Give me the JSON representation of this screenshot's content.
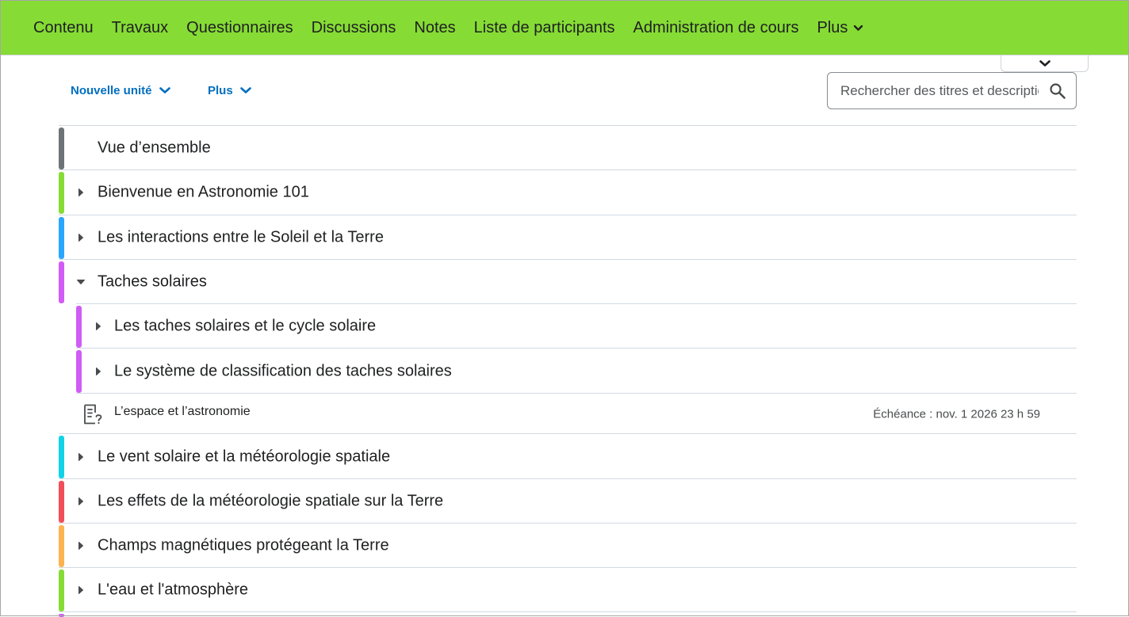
{
  "nav": {
    "items": [
      "Contenu",
      "Travaux",
      "Questionnaires",
      "Discussions",
      "Notes",
      "Liste de participants",
      "Administration de cours"
    ],
    "more_label": "Plus",
    "color": "#86dc34"
  },
  "toolbar": {
    "new_unit_label": "Nouvelle unité",
    "more_label": "Plus",
    "link_color": "#006fbf"
  },
  "search": {
    "placeholder": "Rechercher des titres et descriptions",
    "value": ""
  },
  "content": {
    "overview": {
      "title": "Vue d’ensemble",
      "color": "#6e7376"
    },
    "units": [
      {
        "title": "Bienvenue en Astronomie 101",
        "color": "#86dc34",
        "expanded": false
      },
      {
        "title": "Les interactions entre le Soleil et la Terre",
        "color": "#29a6ff",
        "expanded": false
      },
      {
        "title": "Taches solaires",
        "color": "#d05cf5",
        "expanded": true
      }
    ],
    "subunits": [
      {
        "title": "Les taches solaires et le cycle solaire",
        "color": "#d05cf5"
      },
      {
        "title": "Le système de classification des taches solaires",
        "color": "#d05cf5"
      }
    ],
    "activity": {
      "title": "L’espace et l’astronomie",
      "due": "Échéance : nov. 1 2026 23 h 59",
      "icon": "quiz-icon"
    },
    "units_after": [
      {
        "title": "Le vent solaire et la météorologie spatiale",
        "color": "#11d3e8"
      },
      {
        "title": "Les effets de la météorologie spatiale sur la Terre",
        "color": "#f24e59"
      },
      {
        "title": "Champs magnétiques protégeant la Terre",
        "color": "#fbb450"
      },
      {
        "title": "L'eau et l'atmosphère",
        "color": "#86dc34"
      }
    ]
  }
}
